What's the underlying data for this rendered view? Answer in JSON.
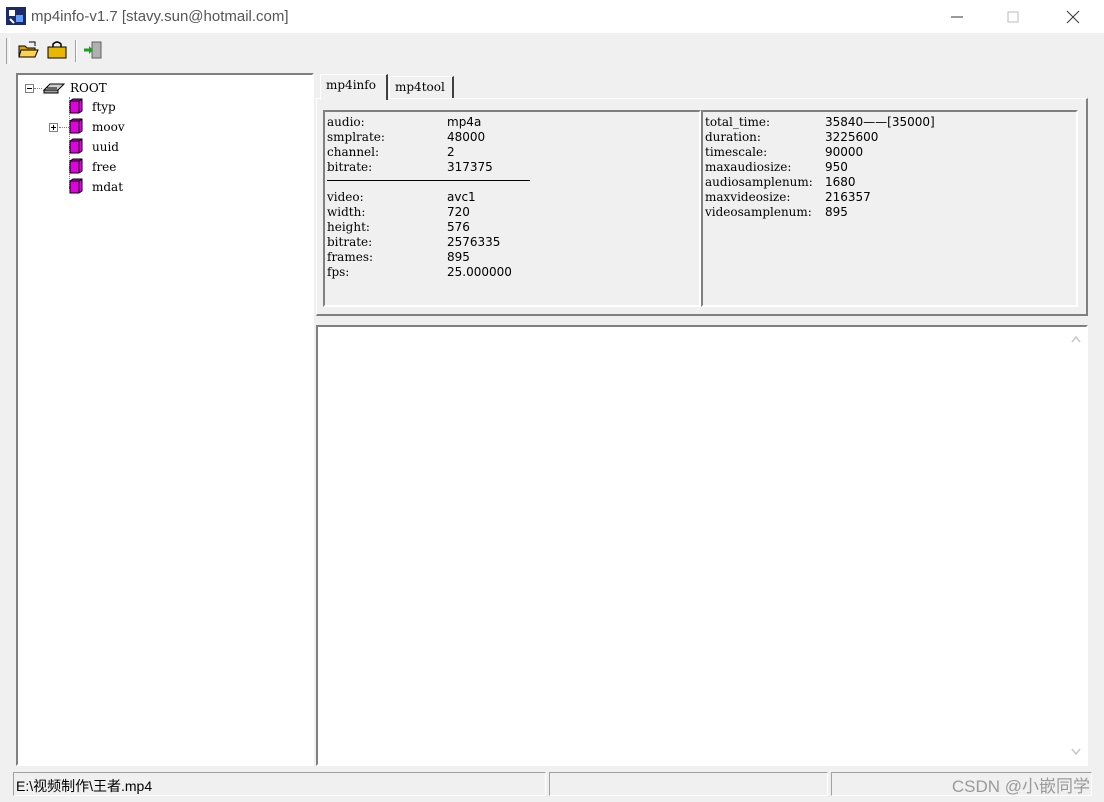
{
  "window": {
    "title": "mp4info-v1.7 [stavy.sun@hotmail.com]"
  },
  "toolbar": {
    "open_icon": "folder-open-icon",
    "close_file_icon": "folder-lock-icon",
    "exit_icon": "exit-door-icon"
  },
  "tree": {
    "root": "ROOT",
    "items": [
      {
        "label": "ftyp",
        "expandable": false
      },
      {
        "label": "moov",
        "expandable": true
      },
      {
        "label": "uuid",
        "expandable": false
      },
      {
        "label": "free",
        "expandable": false
      },
      {
        "label": "mdat",
        "expandable": false
      }
    ]
  },
  "tabs": [
    {
      "label": "mp4info",
      "active": true
    },
    {
      "label": "mp4tool",
      "active": false
    }
  ],
  "info_left": [
    {
      "key": "audio:",
      "value": "mp4a"
    },
    {
      "key": "smplrate:",
      "value": "48000"
    },
    {
      "key": "channel:",
      "value": "2"
    },
    {
      "key": "bitrate:",
      "value": "317375"
    },
    {
      "key": "video:",
      "value": "avc1"
    },
    {
      "key": "width:",
      "value": "720"
    },
    {
      "key": "height:",
      "value": "576"
    },
    {
      "key": "bitrate:",
      "value": "2576335"
    },
    {
      "key": "frames:",
      "value": "895"
    },
    {
      "key": "fps:",
      "value": "25.000000"
    }
  ],
  "info_right": [
    {
      "key": "total_time:",
      "value": "35840——[35000]"
    },
    {
      "key": "duration:",
      "value": "3225600"
    },
    {
      "key": "timescale:",
      "value": "90000"
    },
    {
      "key": "maxaudiosize:",
      "value": "950"
    },
    {
      "key": "audiosamplenum:",
      "value": "1680"
    },
    {
      "key": "maxvideosize:",
      "value": "216357"
    },
    {
      "key": "videosamplenum:",
      "value": "895"
    }
  ],
  "status": {
    "path": "E:\\视频制作\\王者.mp4",
    "pane2": "",
    "pane3": ""
  },
  "watermark": "CSDN @小嵌同学",
  "colors": {
    "box_icon": "#e000e0",
    "window_bg": "#f0f0f0"
  }
}
